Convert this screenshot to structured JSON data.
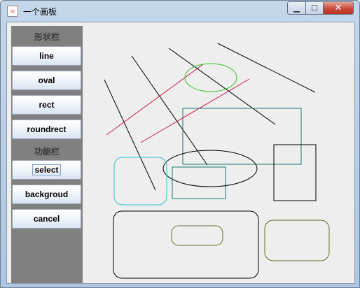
{
  "window": {
    "title": "一个画板",
    "icon": "java-cup-icon",
    "controls": {
      "minimize": "▁",
      "maximize": "☐",
      "close": "✕"
    }
  },
  "sidebar": {
    "shape_section_label": "形状栏",
    "function_section_label": "功能栏",
    "shape_buttons": [
      "line",
      "oval",
      "rect",
      "roundrect"
    ],
    "function_buttons": [
      "select",
      "backgroud",
      "cancel"
    ],
    "focused_button": "select"
  },
  "colors": {
    "panel_gray": "#808080",
    "canvas_bg": "#eeeeee",
    "black": "#000000",
    "crimson": "#c81e46",
    "green": "#35c427",
    "teal": "#147a6e",
    "cyan": "#2ec5c9",
    "olive": "#6b6b2a"
  }
}
